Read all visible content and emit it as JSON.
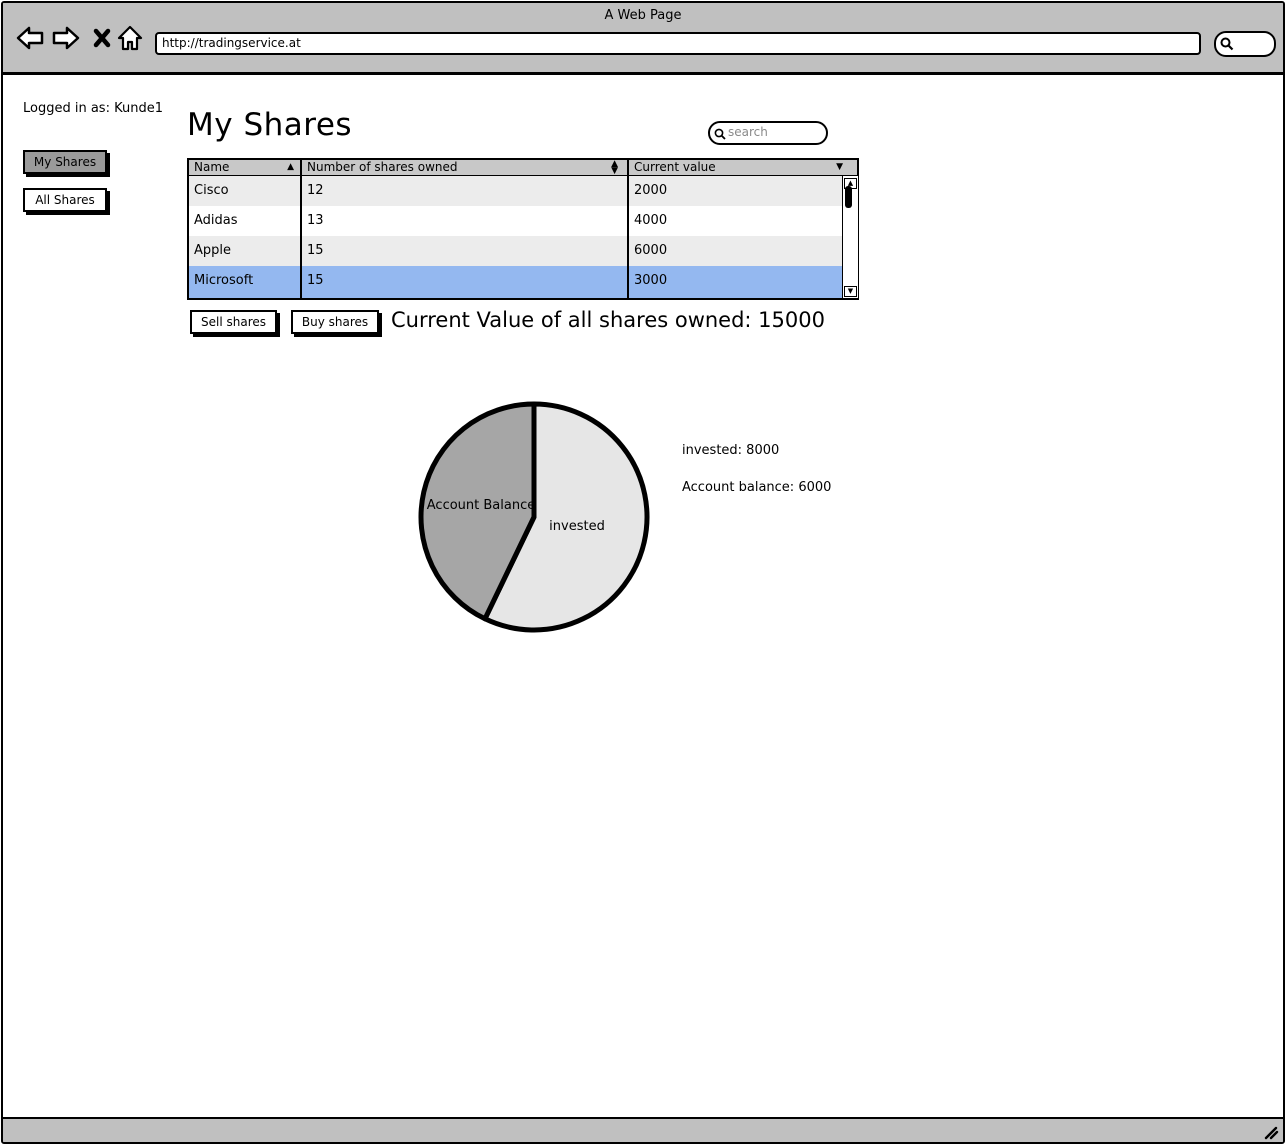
{
  "browser": {
    "window_title": "A Web Page",
    "url": "http://tradingservice.at"
  },
  "sidebar": {
    "logged_in": "Logged in as: Kunde1",
    "items": [
      {
        "label": "My Shares",
        "active": true
      },
      {
        "label": "All Shares",
        "active": false
      }
    ]
  },
  "main": {
    "title": "My Shares",
    "search": {
      "placeholder": "search",
      "value": ""
    },
    "table": {
      "columns": [
        "Name",
        "Number of shares owned",
        "Current value"
      ],
      "rows": [
        {
          "name": "Cisco",
          "shares": "12",
          "value": "2000"
        },
        {
          "name": "Adidas",
          "shares": "13",
          "value": "4000"
        },
        {
          "name": "Apple",
          "shares": "15",
          "value": "6000"
        },
        {
          "name": "Microsoft",
          "shares": "15",
          "value": "3000",
          "selected": true
        }
      ]
    },
    "actions": {
      "sell": "Sell shares",
      "buy": "Buy shares"
    },
    "total_label": "Current Value of all shares owned: 15000"
  },
  "chart_data": {
    "type": "pie",
    "slices": [
      {
        "label": "invested",
        "value": 8000,
        "color": "#e6e6e6"
      },
      {
        "label": "Account Balance",
        "value": 6000,
        "color": "#a6a6a6"
      }
    ],
    "legend": [
      "invested: 8000",
      "Account balance: 6000"
    ]
  },
  "colors": {
    "chrome": "#c0c0c0",
    "selected_row": "#94b8f0",
    "row_alt": "#ececec",
    "header": "#c8c8c8"
  },
  "icons": [
    "back-arrow-icon",
    "forward-arrow-icon",
    "close-icon",
    "home-icon",
    "search-icon",
    "resize-grip-icon"
  ]
}
